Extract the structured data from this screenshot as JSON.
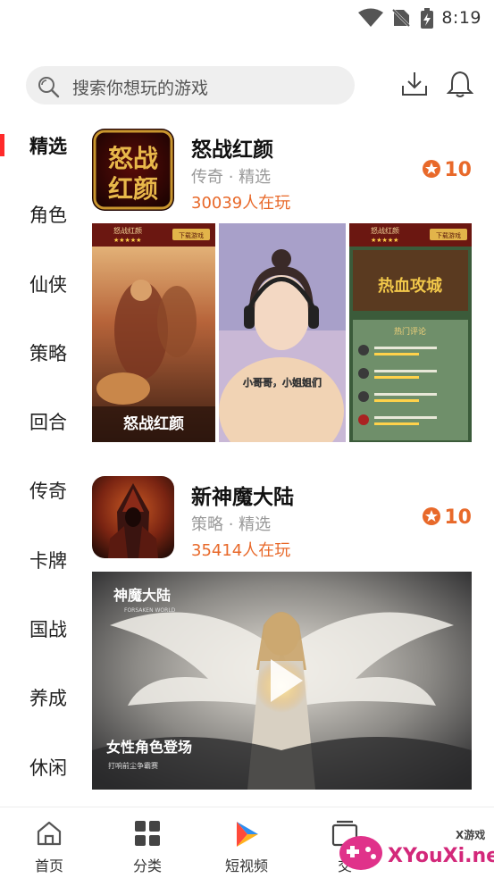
{
  "status_bar": {
    "time": "8:19"
  },
  "search": {
    "placeholder": "搜索你想玩的游戏"
  },
  "sidebar": {
    "items": [
      {
        "label": "精选",
        "active": true
      },
      {
        "label": "角色"
      },
      {
        "label": "仙侠"
      },
      {
        "label": "策略"
      },
      {
        "label": "回合"
      },
      {
        "label": "传奇"
      },
      {
        "label": "卡牌"
      },
      {
        "label": "国战"
      },
      {
        "label": "养成"
      },
      {
        "label": "休闲"
      }
    ]
  },
  "games": [
    {
      "name": "怒战红颜",
      "meta": "传奇 · 精选",
      "players": "30039人在玩",
      "score": "10",
      "icon_text": [
        "怒战",
        "红颜"
      ],
      "screens": {
        "left_banner": "怒战红颜",
        "left_download": "下载游戏",
        "left_title": "怒战红颜",
        "middle_caption": "小哥哥，小姐姐们",
        "right_title": "怒战红颜",
        "right_download": "下载游戏",
        "right_banner": "热血攻城",
        "right_section": "热门评论"
      }
    },
    {
      "name": "新神魔大陆",
      "meta": "策略 · 精选",
      "players": "35414人在玩",
      "score": "10",
      "video": {
        "logo": "神魔大陆",
        "logo_sub": "FORSAKEN WORLD",
        "caption": "女性角色登场",
        "caption_sub": "打响前尘争霸赛"
      }
    }
  ],
  "bottom_nav": [
    {
      "label": "首页",
      "icon": "home-icon"
    },
    {
      "label": "分类",
      "icon": "category-icon"
    },
    {
      "label": "短视频",
      "icon": "video-icon"
    },
    {
      "label": "交",
      "icon": "trade-icon"
    }
  ],
  "watermark": {
    "text": "XYouXi.net",
    "small": "X游戏"
  },
  "colors": {
    "accent": "#e8692a",
    "active_bar": "#ff2a2a",
    "search_bg": "#efefef"
  }
}
